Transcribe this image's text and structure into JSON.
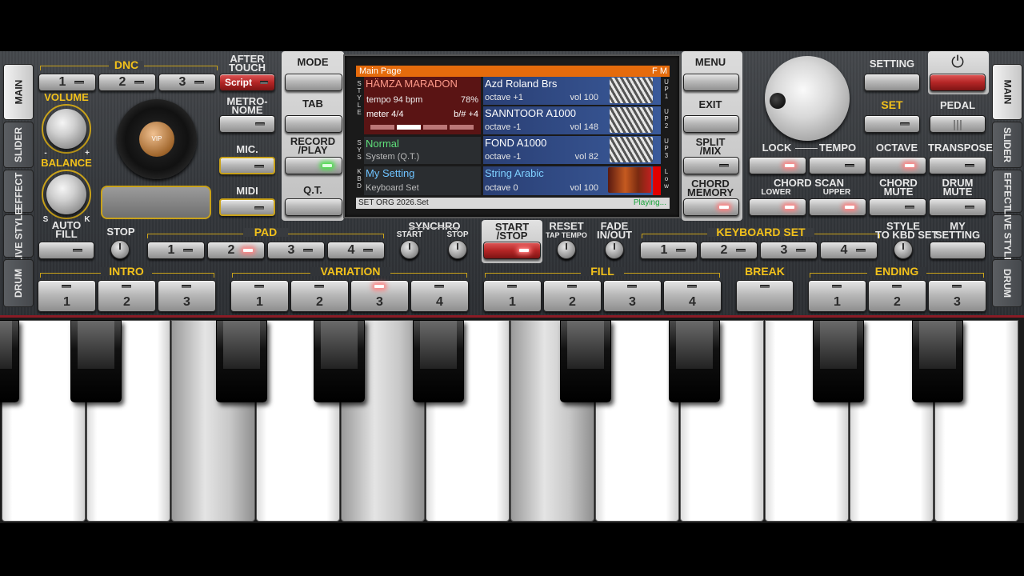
{
  "sidebar_left": [
    {
      "label": "MAIN",
      "active": true
    },
    {
      "label": "SLIDER"
    },
    {
      "label": "EFFECT"
    },
    {
      "label": "LIVE STYLE"
    },
    {
      "label": "DRUM"
    }
  ],
  "sidebar_right": [
    {
      "label": "MAIN",
      "active": true
    },
    {
      "label": "SLIDER"
    },
    {
      "label": "EFFECT"
    },
    {
      "label": "LIVE STYLE"
    },
    {
      "label": "DRUM"
    }
  ],
  "dnc": {
    "label": "DNC",
    "buttons": [
      "1",
      "2",
      "3"
    ]
  },
  "after_touch": {
    "label": "AFTER TOUCH",
    "button": "Script"
  },
  "metronome": {
    "label": "METRO- NOME"
  },
  "mic": {
    "label": "MIC."
  },
  "midi": {
    "label": "MIDI"
  },
  "volume": {
    "label": "VOLUME",
    "minus": "-",
    "plus": "+"
  },
  "balance": {
    "label": "BALANCE",
    "s": "S",
    "k": "K"
  },
  "vip": {
    "label": "VIP"
  },
  "mode": {
    "label": "MODE"
  },
  "tab": {
    "label": "TAB"
  },
  "record": {
    "label": "RECORD /PLAY"
  },
  "qt": {
    "label": "Q.T."
  },
  "menu": {
    "label": "MENU"
  },
  "exit": {
    "label": "EXIT"
  },
  "split": {
    "label": "SPLIT /MIX"
  },
  "chord_memory": {
    "label": "CHORD MEMORY"
  },
  "screen": {
    "header": "Main Page",
    "header_right": "F M",
    "style": {
      "name": "HÄMZA MARADON",
      "tempo": "tempo 94 bpm",
      "percent": "78%",
      "meter": "meter 4/4",
      "key": "b/# +4",
      "side": "S T Y L E"
    },
    "sys": {
      "name": "Normal",
      "sub": "System (Q.T.)",
      "side": "S Y S"
    },
    "kbd": {
      "name": "My Setting",
      "sub": "Keyboard Set",
      "side": "K B D"
    },
    "up1": {
      "name": "Azd Roland Brs",
      "octave": "octave +1",
      "vol": "vol 100",
      "side": "U P 1"
    },
    "up2": {
      "name": "SANNTOOR A1000",
      "octave": "octave -1",
      "vol": "vol 148",
      "side": "U P 2"
    },
    "up3": {
      "name": "FOND A1000",
      "octave": "octave -1",
      "vol": "vol 82",
      "side": "U P 3"
    },
    "low": {
      "name": "String Arabic",
      "octave": "octave  0",
      "vol": "vol 100",
      "side": "L o w"
    },
    "footer_left": "SET ORG 2026.Set",
    "footer_right": "Playing..."
  },
  "setting": {
    "label": "SETTING"
  },
  "set": {
    "label": "SET"
  },
  "pedal": {
    "label": "PEDAL"
  },
  "lock": {
    "label": "LOCK"
  },
  "tempo": {
    "label": "TEMPO"
  },
  "octave": {
    "label": "OCTAVE"
  },
  "transpose": {
    "label": "TRANSPOSE"
  },
  "chord_scan": {
    "label": "CHORD SCAN",
    "lower": "LOWER",
    "upper": "UPPER"
  },
  "chord_mute": {
    "label": "CHORD MUTE"
  },
  "drum_mute": {
    "label": "DRUM MUTE"
  },
  "auto_fill": {
    "label": "AUTO FILL"
  },
  "stop": {
    "label": "STOP"
  },
  "pad": {
    "label": "PAD",
    "buttons": [
      "1",
      "2",
      "3",
      "4"
    ]
  },
  "synchro": {
    "label": "SYNCHRO",
    "start": "START",
    "stop": "STOP"
  },
  "start_stop": {
    "label": "START /STOP"
  },
  "reset": {
    "label": "RESET",
    "sub": "TAP TEMPO"
  },
  "fade": {
    "label": "FADE IN/OUT"
  },
  "keyboard_set": {
    "label": "KEYBOARD SET",
    "buttons": [
      "1",
      "2",
      "3",
      "4"
    ]
  },
  "style_to_kbd": {
    "label": "STYLE TO KBD SET"
  },
  "my_setting": {
    "label": "MY SETTING"
  },
  "intro": {
    "label": "INTRO",
    "buttons": [
      "1",
      "2",
      "3"
    ]
  },
  "variation": {
    "label": "VARIATION",
    "buttons": [
      "1",
      "2",
      "3",
      "4"
    ]
  },
  "fill": {
    "label": "FILL",
    "buttons": [
      "1",
      "2",
      "3",
      "4"
    ]
  },
  "break": {
    "label": "BREAK"
  },
  "ending": {
    "label": "ENDING",
    "buttons": [
      "1",
      "2",
      "3"
    ]
  },
  "colors": {
    "accent": "#f2c11b",
    "header": "#e56b0c",
    "red_button": "#b52626"
  }
}
